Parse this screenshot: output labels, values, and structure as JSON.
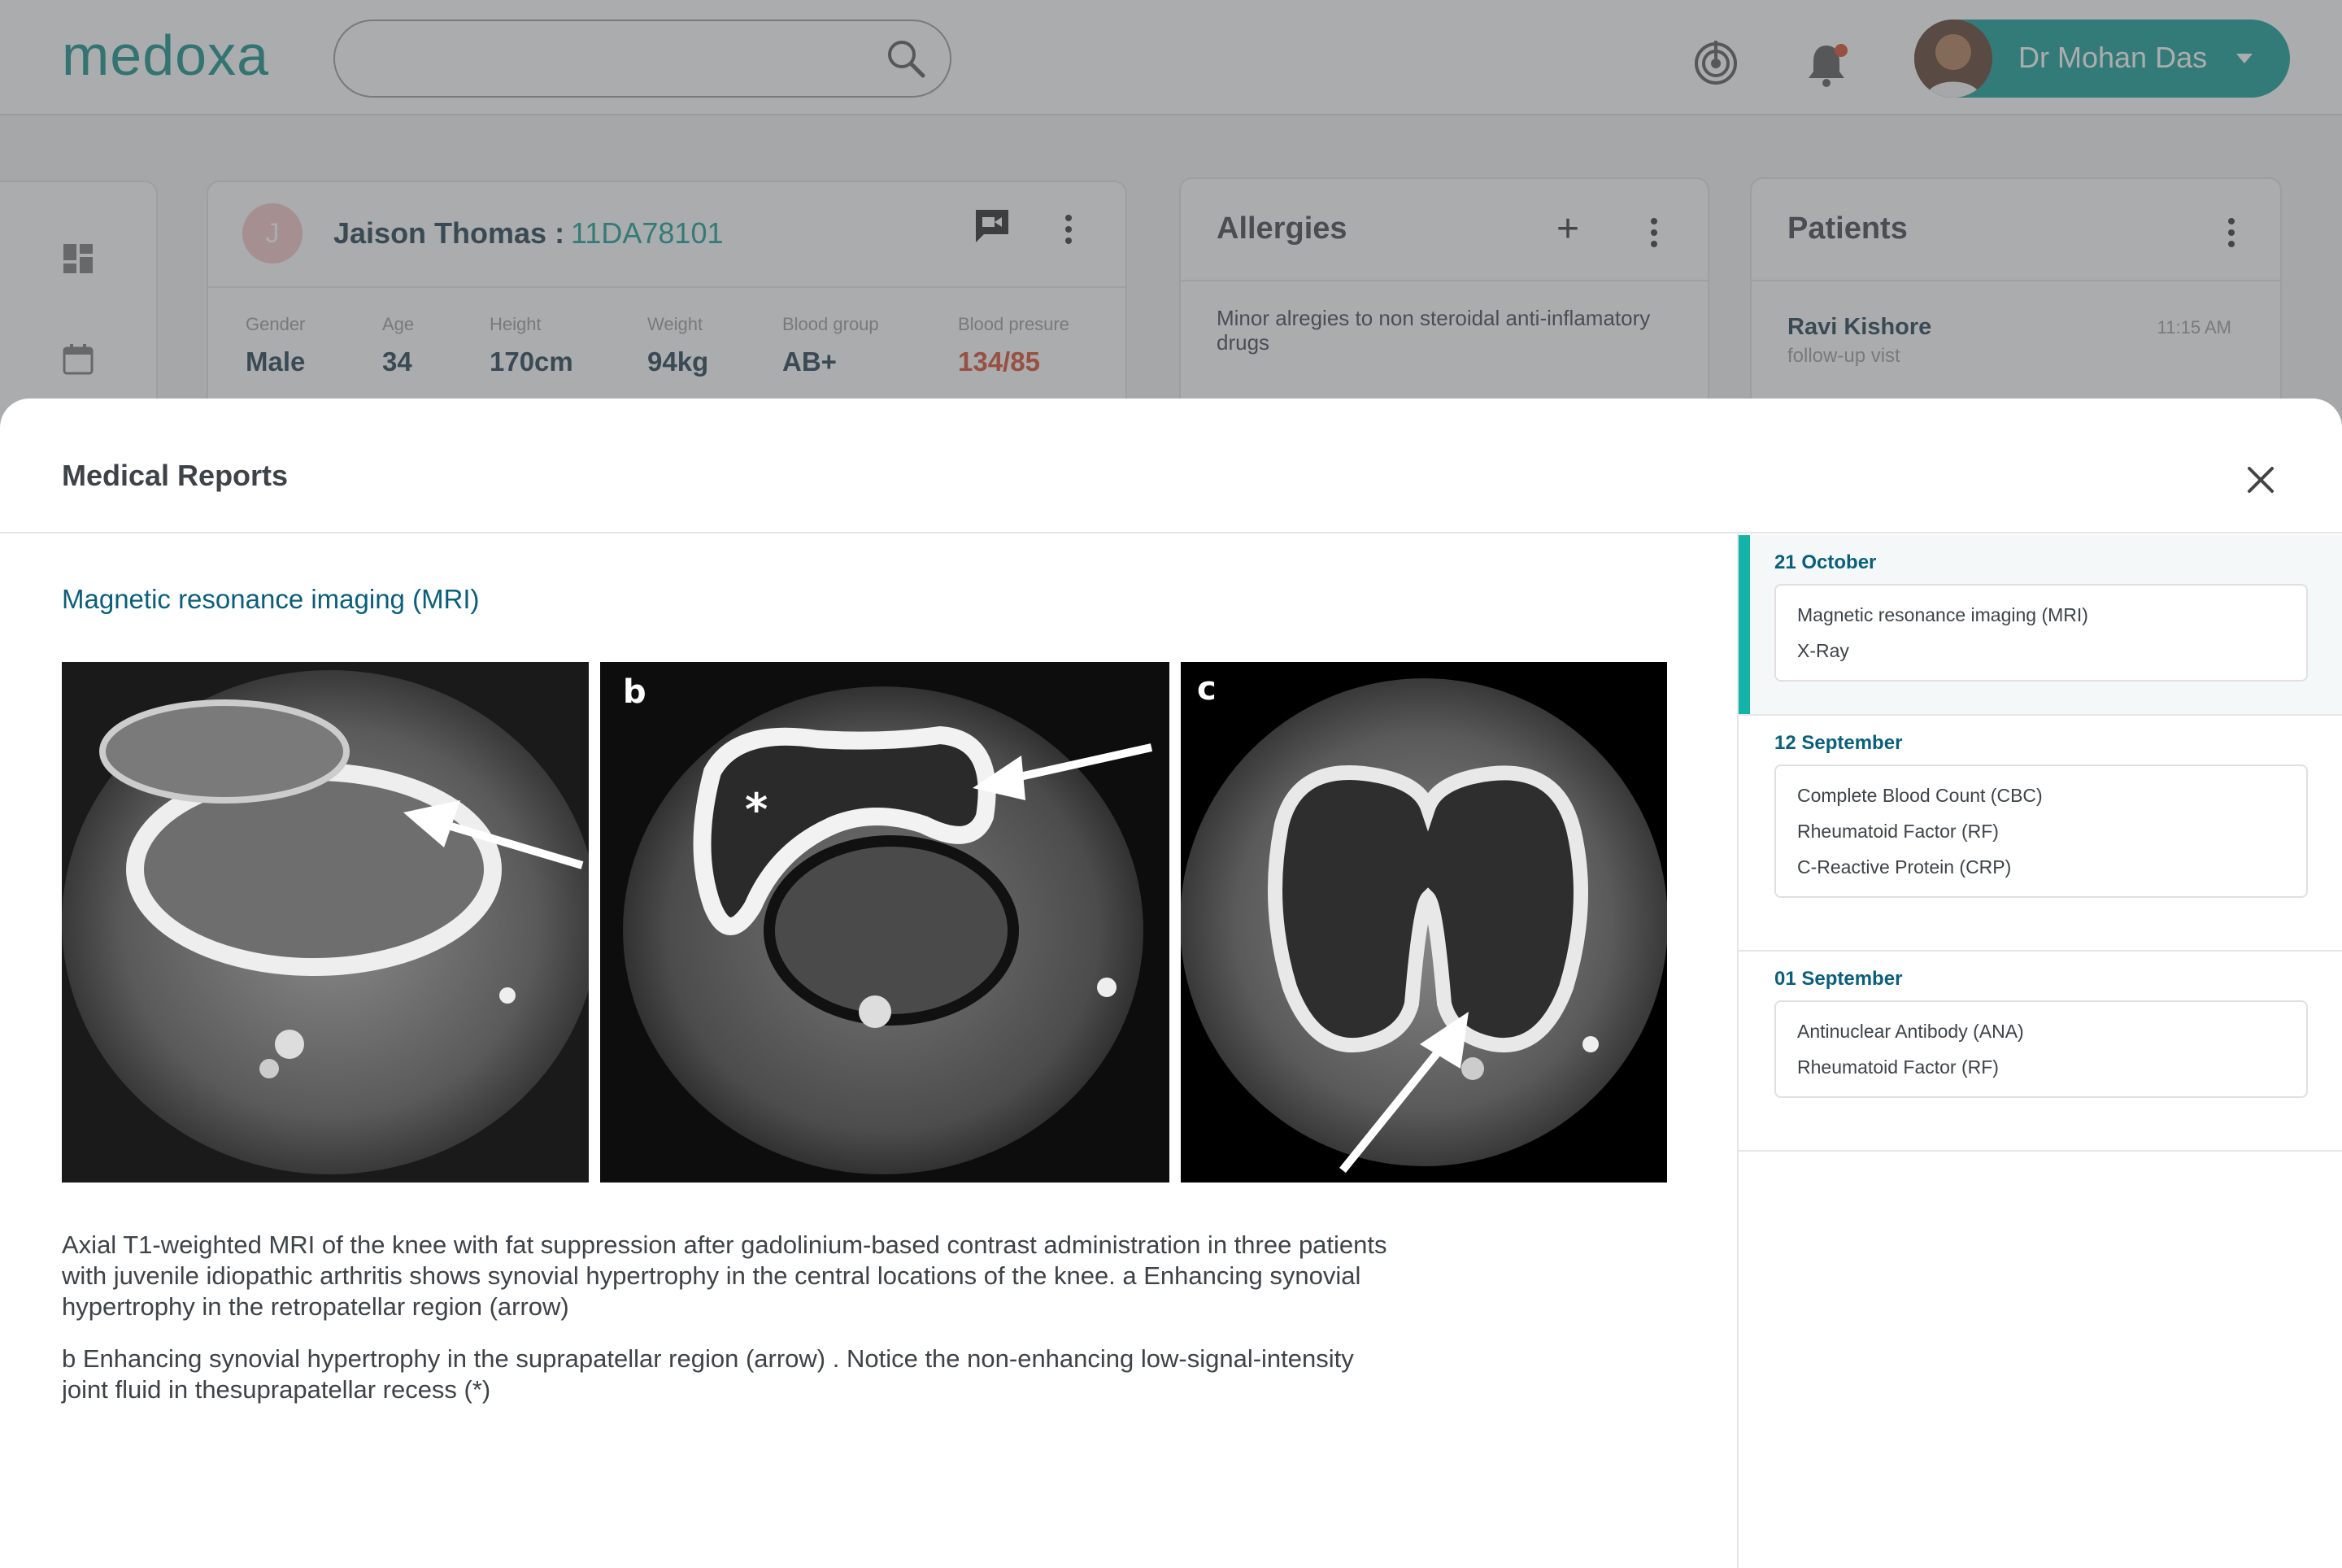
{
  "app": {
    "logo": "medoxa",
    "brand_color": "#0f9c94"
  },
  "header": {
    "search_placeholder": "",
    "user_name": "Dr Mohan Das",
    "icons": [
      "search-icon",
      "fingerprint-icon",
      "bell-icon",
      "avatar",
      "caret-down-icon"
    ]
  },
  "patient": {
    "avatar_initial": "J",
    "name": "Jaison Thomas :",
    "id": "11DA78101",
    "vitals": [
      {
        "label": "Gender",
        "value": "Male"
      },
      {
        "label": "Age",
        "value": "34"
      },
      {
        "label": "Height",
        "value": "170cm"
      },
      {
        "label": "Weight",
        "value": "94kg"
      },
      {
        "label": "Blood group",
        "value": "AB+"
      },
      {
        "label": "Blood presure",
        "value": "134/85"
      }
    ]
  },
  "allergies": {
    "title": "Allergies",
    "items": [
      "Minor alregies to non steroidal anti-inflamatory drugs"
    ]
  },
  "patients": {
    "title": "Patients",
    "items": [
      {
        "name": "Ravi Kishore",
        "sub": "follow-up vist",
        "time": "11:15 AM"
      }
    ]
  },
  "modal": {
    "title": "Medical Reports",
    "report_title": "Magnetic resonance imaging (MRI)",
    "panel_labels": [
      "b",
      "c"
    ],
    "description": [
      "Axial T1-weighted MRI of the knee with fat suppression after gadolinium-based contrast administration in three patients with juvenile idiopathic arthritis shows synovial hypertrophy in the central locations of the knee. a Enhancing synovial hypertrophy in the retropatellar region (arrow)",
      "b Enhancing synovial hypertrophy in the suprapatellar region (arrow) . Notice the non-enhancing low-signal-intensity joint fluid in thesuprapatellar recess (*)"
    ],
    "history": [
      {
        "date": "21 October",
        "items": [
          "Magnetic resonance imaging (MRI)",
          "X-Ray"
        ],
        "active": true
      },
      {
        "date": "12 September",
        "items": [
          "Complete Blood Count (CBC)",
          "Rheumatoid Factor (RF)",
          "C-Reactive Protein (CRP)"
        ],
        "active": false
      },
      {
        "date": "01 September",
        "items": [
          "Antinuclear Antibody (ANA)",
          "Rheumatoid Factor (RF)"
        ],
        "active": false
      }
    ]
  }
}
